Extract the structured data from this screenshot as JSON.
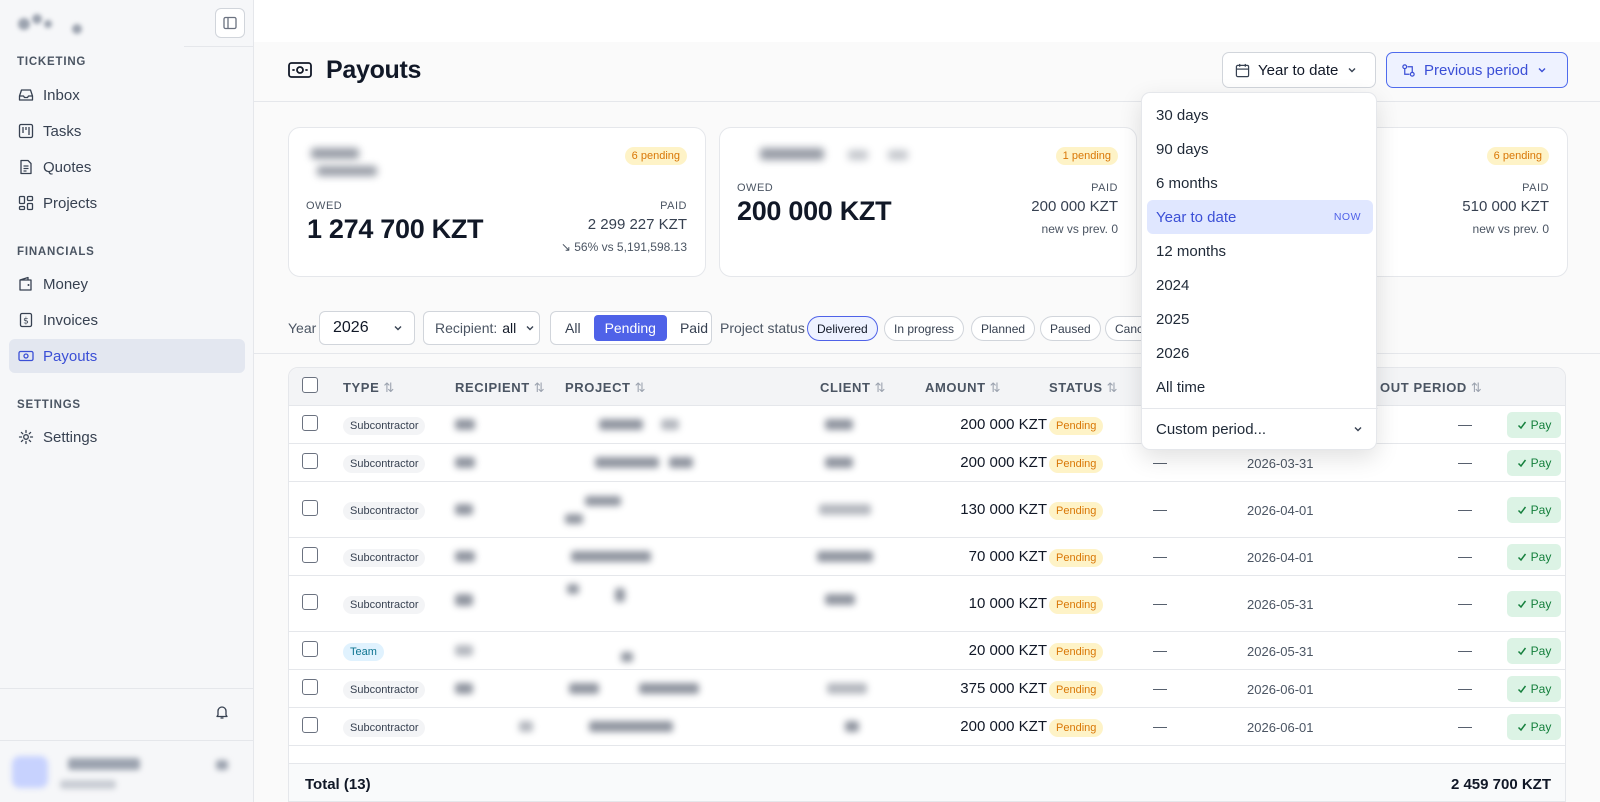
{
  "sidebar": {
    "sections": [
      {
        "label": "TICKETING",
        "items": [
          {
            "label": "Inbox",
            "icon": "inbox-icon"
          },
          {
            "label": "Tasks",
            "icon": "kanban-icon"
          },
          {
            "label": "Quotes",
            "icon": "document-icon"
          },
          {
            "label": "Projects",
            "icon": "grid-icon"
          }
        ]
      },
      {
        "label": "FINANCIALS",
        "items": [
          {
            "label": "Money",
            "icon": "wallet-icon"
          },
          {
            "label": "Invoices",
            "icon": "dollar-file-icon"
          },
          {
            "label": "Payouts",
            "icon": "banknote-icon",
            "active": true
          }
        ]
      },
      {
        "label": "SETTINGS",
        "items": [
          {
            "label": "Settings",
            "icon": "gear-icon"
          }
        ]
      }
    ]
  },
  "header": {
    "title": "Payouts",
    "range_label": "Year to date",
    "compare_label": "Previous period"
  },
  "cards": [
    {
      "pending": "6 pending",
      "owed_label": "OWED",
      "owed": "1 274 700 KZT",
      "paid_label": "PAID",
      "paid": "2 299 227 KZT",
      "delta": "↘ 56%  vs 5,191,598.13"
    },
    {
      "pending": "1 pending",
      "owed_label": "OWED",
      "owed": "200 000 KZT",
      "paid_label": "PAID",
      "paid": "200 000 KZT",
      "delta": "new vs prev. 0"
    },
    {
      "pending": "6 pending",
      "paid_label": "PAID",
      "paid": "510 000 KZT",
      "delta": "new vs prev. 0"
    }
  ],
  "filters": {
    "year_label": "Year",
    "year_value": "2026",
    "recipient_label": "Recipient:",
    "recipient_value": "all",
    "segments": [
      "All",
      "Pending",
      "Paid"
    ],
    "segment_active": "Pending",
    "project_status_label": "Project status",
    "project_status": [
      {
        "label": "Delivered",
        "active": true
      },
      {
        "label": "In progress"
      },
      {
        "label": "Planned"
      },
      {
        "label": "Paused"
      },
      {
        "label": "Canc"
      }
    ]
  },
  "table": {
    "columns": [
      "TYPE",
      "RECIPIENT",
      "PROJECT",
      "CLIENT",
      "AMOUNT",
      "STATUS",
      "OUT PERIOD"
    ],
    "rows": [
      {
        "type": "Subcontractor",
        "amount": "200 000 KZT",
        "status": "Pending",
        "paid": "",
        "date": "",
        "period": "—",
        "action": "Pay"
      },
      {
        "type": "Subcontractor",
        "amount": "200 000 KZT",
        "status": "Pending",
        "paid": "—",
        "date": "2026-03-31",
        "period": "—",
        "action": "Pay"
      },
      {
        "type": "Subcontractor",
        "amount": "130 000 KZT",
        "status": "Pending",
        "paid": "—",
        "date": "2026-04-01",
        "period": "—",
        "action": "Pay"
      },
      {
        "type": "Subcontractor",
        "amount": "70 000 KZT",
        "status": "Pending",
        "paid": "—",
        "date": "2026-04-01",
        "period": "—",
        "action": "Pay"
      },
      {
        "type": "Subcontractor",
        "amount": "10 000 KZT",
        "status": "Pending",
        "paid": "—",
        "date": "2026-05-31",
        "period": "—",
        "action": "Pay"
      },
      {
        "type": "Team",
        "amount": "20 000 KZT",
        "status": "Pending",
        "paid": "—",
        "date": "2026-05-31",
        "period": "—",
        "action": "Pay"
      },
      {
        "type": "Subcontractor",
        "amount": "375 000 KZT",
        "status": "Pending",
        "paid": "—",
        "date": "2026-06-01",
        "period": "—",
        "action": "Pay"
      },
      {
        "type": "Subcontractor",
        "amount": "200 000 KZT",
        "status": "Pending",
        "paid": "—",
        "date": "2026-06-01",
        "period": "—",
        "action": "Pay"
      }
    ],
    "total_label": "Total (13)",
    "total_value": "2 459 700 KZT"
  },
  "dropdown": {
    "items": [
      "30 days",
      "90 days",
      "6 months",
      "Year to date",
      "12 months",
      "2024",
      "2025",
      "2026",
      "All time"
    ],
    "active": "Year to date",
    "now_tag": "NOW",
    "custom_label": "Custom period..."
  },
  "colors": {
    "accent": "#4f62e8",
    "pending": "#d97706",
    "pay": "#15803d"
  }
}
